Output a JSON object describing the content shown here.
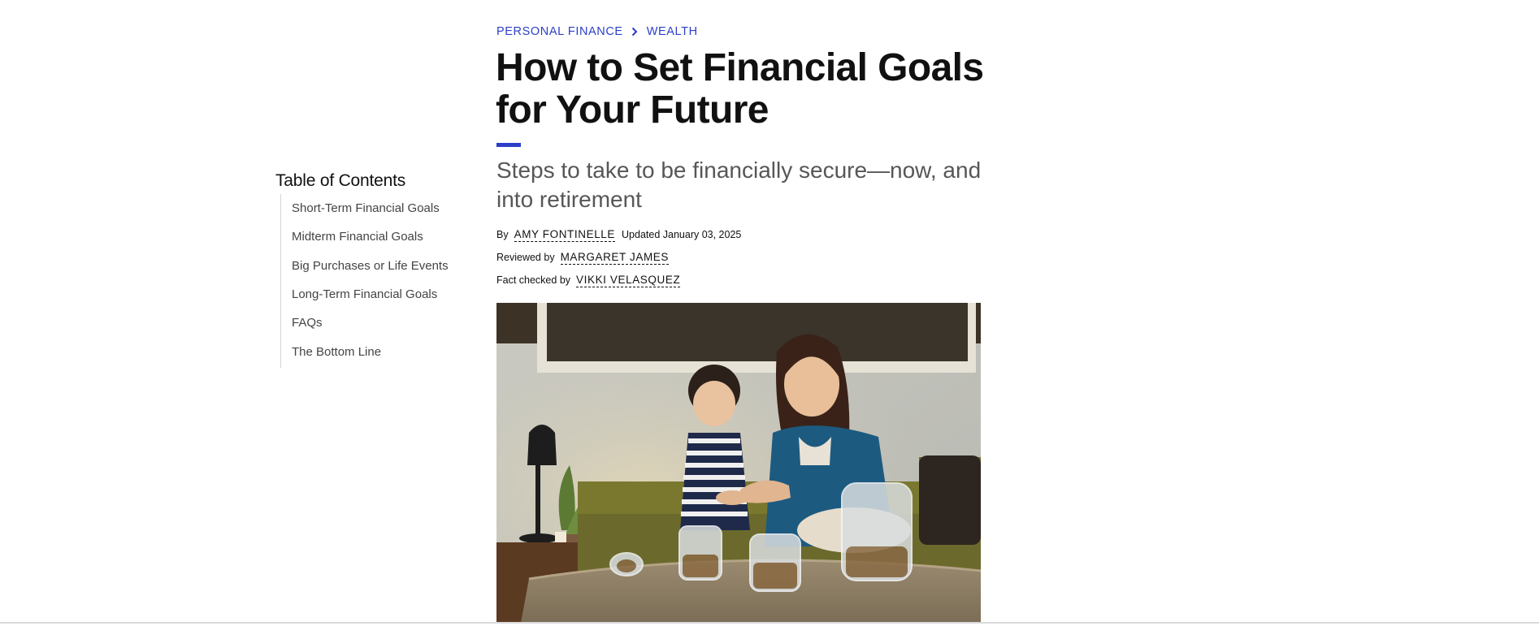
{
  "breadcrumb": {
    "items": [
      "PERSONAL FINANCE",
      "WEALTH"
    ]
  },
  "article": {
    "title": "How to Set Financial Goals for Your Future",
    "subtitle": "Steps to take to be financially secure—now, and into retirement",
    "byline": {
      "by_label": "By",
      "author": "AMY FONTINELLE",
      "updated": "Updated January 03, 2025",
      "reviewed_label": "Reviewed by",
      "reviewer": "MARGARET JAMES",
      "fact_checked_label": "Fact checked by",
      "fact_checker": "VIKKI VELASQUEZ"
    }
  },
  "toc": {
    "heading": "Table of Contents",
    "items": [
      "Short-Term Financial Goals",
      "Midterm Financial Goals",
      "Big Purchases or Life Events",
      "Long-Term Financial Goals",
      "FAQs",
      "The Bottom Line"
    ]
  },
  "colors": {
    "accent": "#2c3ec9",
    "text": "#111111",
    "subtitle": "#575757"
  }
}
